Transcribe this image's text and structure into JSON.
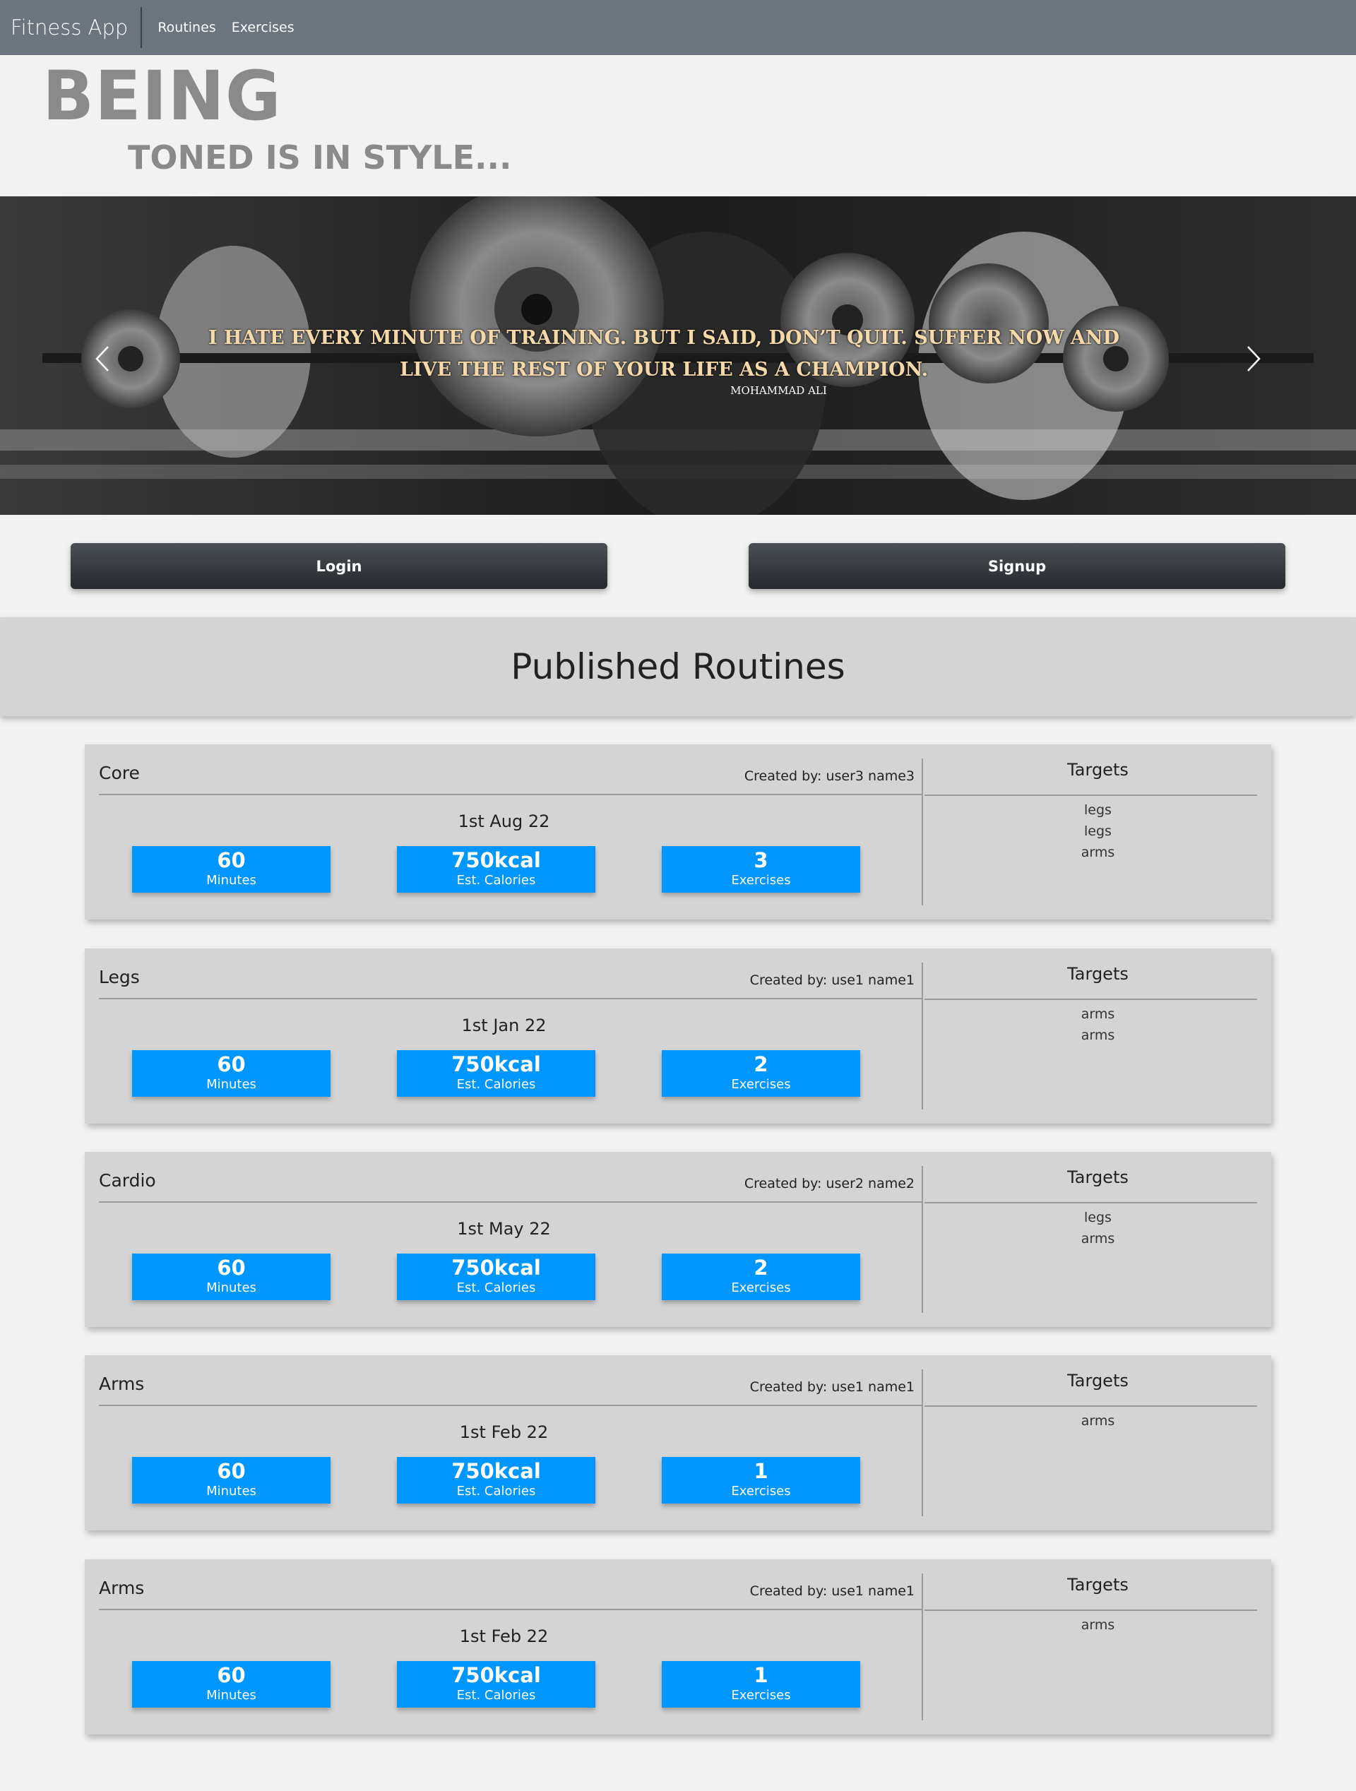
{
  "nav": {
    "brand": "Fitness App",
    "links": [
      "Routines",
      "Exercises"
    ]
  },
  "hero": {
    "title": "BEING",
    "subtitle": "TONED IS IN STYLE..."
  },
  "carousel": {
    "quote": "I HATE EVERY MINUTE OF TRAINING. BUT I SAID, DON’T QUIT. SUFFER NOW AND LIVE THE REST OF YOUR LIFE AS A CHAMPION.",
    "author": "MOHAMMAD ALI"
  },
  "auth": {
    "login_label": "Login",
    "signup_label": "Signup"
  },
  "routines_title": "Published Routines",
  "targets_label": "Targets",
  "stat_labels": {
    "minutes": "Minutes",
    "calories": "Est. Calories",
    "exercises": "Exercises"
  },
  "colors": {
    "stat_blue": "#0096ff",
    "navbar": "#6c757d",
    "card_bg": "#d4d4d4"
  },
  "routines": [
    {
      "name": "Core",
      "author": "Created by: user3 name3",
      "date": "1st Aug 22",
      "minutes": "60",
      "calories": "750kcal",
      "exercises": "3",
      "targets": [
        "legs",
        "legs",
        "arms"
      ]
    },
    {
      "name": "Legs",
      "author": "Created by: use1 name1",
      "date": "1st Jan 22",
      "minutes": "60",
      "calories": "750kcal",
      "exercises": "2",
      "targets": [
        "arms",
        "arms"
      ]
    },
    {
      "name": "Cardio",
      "author": "Created by: user2 name2",
      "date": "1st May 22",
      "minutes": "60",
      "calories": "750kcal",
      "exercises": "2",
      "targets": [
        "legs",
        "arms"
      ]
    },
    {
      "name": "Arms",
      "author": "Created by: use1 name1",
      "date": "1st Feb 22",
      "minutes": "60",
      "calories": "750kcal",
      "exercises": "1",
      "targets": [
        "arms"
      ]
    },
    {
      "name": "Arms",
      "author": "Created by: use1 name1",
      "date": "1st Feb 22",
      "minutes": "60",
      "calories": "750kcal",
      "exercises": "1",
      "targets": [
        "arms"
      ]
    }
  ]
}
